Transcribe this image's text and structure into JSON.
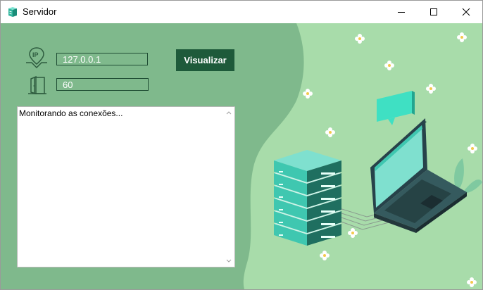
{
  "window": {
    "title": "Servidor"
  },
  "icons": {
    "app": "server-app-icon",
    "ip": "ip-location-icon",
    "port": "door-icon",
    "minimize": "minimize-icon",
    "maximize": "maximize-icon",
    "close": "close-icon"
  },
  "form": {
    "ip_value": "127.0.0.1",
    "port_value": "60",
    "visualize_label": "Visualizar"
  },
  "log": {
    "text": "Monitorando as conexões..."
  },
  "colors": {
    "background": "#a8dcaa",
    "panel": "#7fb98c",
    "button": "#1e5a3a",
    "accent_teal": "#3fc7b0"
  }
}
